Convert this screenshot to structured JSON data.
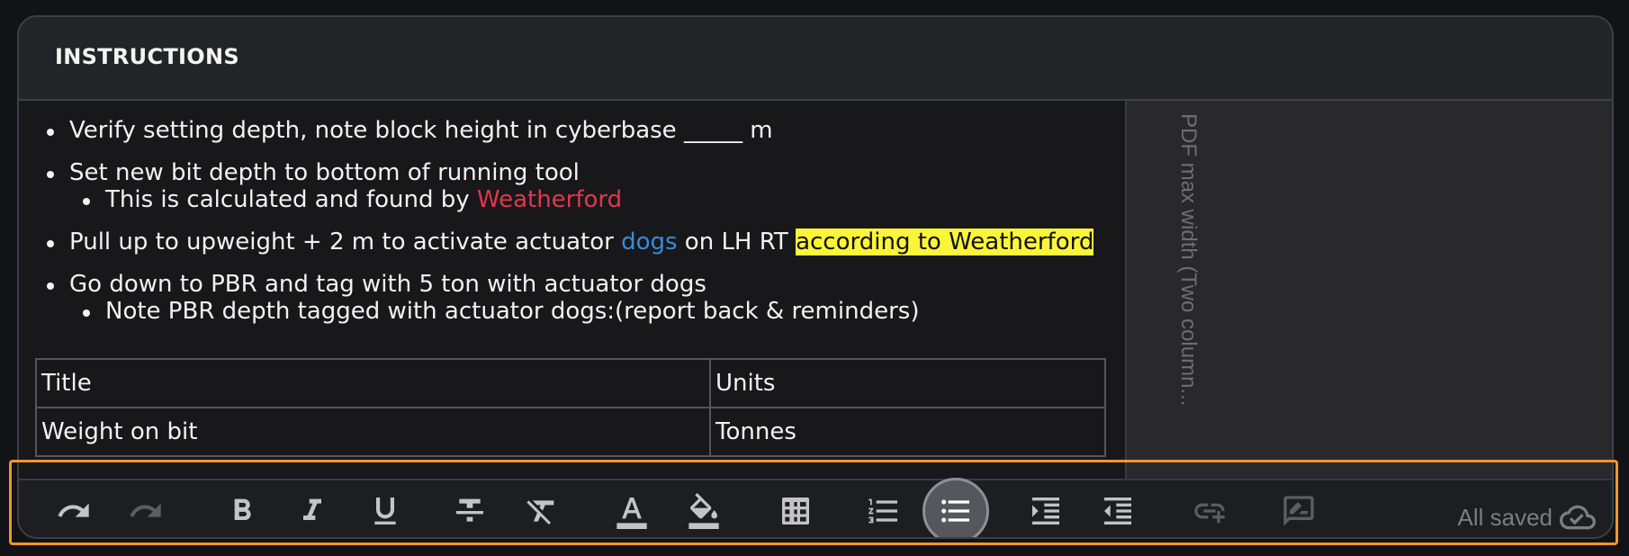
{
  "panel": {
    "title": "INSTRUCTIONS"
  },
  "editor": {
    "item1": "Verify setting depth, note block height in cyberbase _____ m",
    "item2": "Set new bit depth to bottom of running tool",
    "item2_sub_prefix": "This is calculated and found by ",
    "item2_sub_link": "Weatherford",
    "item3_prefix": "Pull up to upweight + 2 m to activate actuator ",
    "item3_blue": "dogs",
    "item3_mid": " on LH RT ",
    "item3_highlight": "according to Weatherford",
    "item4": "Go down to PBR and tag with 5 ton with actuator dogs",
    "item4_sub": "Note PBR depth tagged with actuator dogs:(report back & reminders)",
    "table": {
      "headers": [
        "Title",
        "Units"
      ],
      "rows": [
        [
          "Weight on bit",
          "Tonnes"
        ]
      ]
    }
  },
  "side_panel": {
    "label": "PDF max width (Two column..."
  },
  "toolbar": {
    "status": "All saved",
    "buttons": [
      {
        "icon": "undo-icon",
        "state": "enabled"
      },
      {
        "icon": "redo-icon",
        "state": "disabled"
      },
      {
        "icon": "bold-icon",
        "state": "enabled"
      },
      {
        "icon": "italic-icon",
        "state": "enabled"
      },
      {
        "icon": "underline-icon",
        "state": "enabled"
      },
      {
        "icon": "strikethrough-icon",
        "state": "enabled"
      },
      {
        "icon": "clear-format-icon",
        "state": "enabled"
      },
      {
        "icon": "text-color-icon",
        "state": "enabled"
      },
      {
        "icon": "fill-color-icon",
        "state": "enabled"
      },
      {
        "icon": "table-icon",
        "state": "enabled"
      },
      {
        "icon": "numbered-list-icon",
        "state": "enabled"
      },
      {
        "icon": "bulleted-list-icon",
        "state": "active"
      },
      {
        "icon": "indent-icon",
        "state": "enabled"
      },
      {
        "icon": "outdent-icon",
        "state": "enabled"
      },
      {
        "icon": "add-link-icon",
        "state": "disabled"
      },
      {
        "icon": "comment-icon",
        "state": "disabled"
      }
    ]
  },
  "colors": {
    "link_red": "#e0384b",
    "link_blue": "#3a8ad9",
    "highlight": "#fbf539",
    "focus_ring": "#f0962a"
  }
}
